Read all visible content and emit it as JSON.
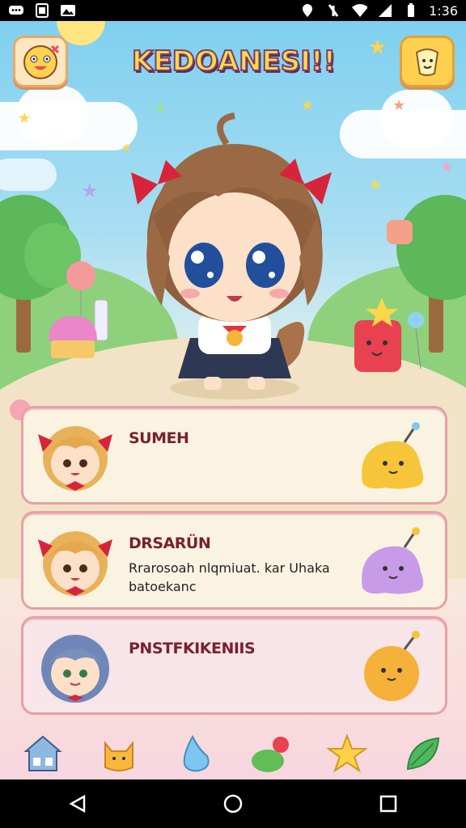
{
  "status_bar": {
    "time": "1:36",
    "left_icons": [
      "chat-icon",
      "image-icon",
      "gallery-icon"
    ],
    "right_icons": [
      "location-icon",
      "alarm-icon",
      "wifi-icon",
      "signal-icon",
      "battery-icon"
    ]
  },
  "game": {
    "title": "KEDOANESI!!",
    "top_left_button_icon": "face-icon",
    "top_right_button_icon": "character-card-icon"
  },
  "cards": [
    {
      "name": "SUMEH",
      "desc": "",
      "avatar_icon": "blonde-girl-avatar",
      "pet_icon": "yellow-slime-pet",
      "pet_color": "#f7c53a"
    },
    {
      "name": "DRSARÜN",
      "desc": "Rrarosoah nlqmiuat. kar Uhaka batoekanc",
      "avatar_icon": "blonde-girl-avatar",
      "pet_icon": "purple-slime-pet",
      "pet_color": "#c89be8"
    },
    {
      "name": "PNSTFKIKENIIS",
      "desc": "",
      "avatar_icon": "blue-hair-avatar",
      "pet_icon": "orange-slime-pet",
      "pet_color": "#f6b13a"
    }
  ],
  "bottom_nav": [
    {
      "icon": "house-icon"
    },
    {
      "icon": "cat-icon"
    },
    {
      "icon": "water-drop-icon"
    },
    {
      "icon": "berry-icon"
    },
    {
      "icon": "star-icon"
    },
    {
      "icon": "leaf-icon"
    }
  ],
  "system_nav": [
    "back-icon",
    "home-icon",
    "recents-icon"
  ]
}
